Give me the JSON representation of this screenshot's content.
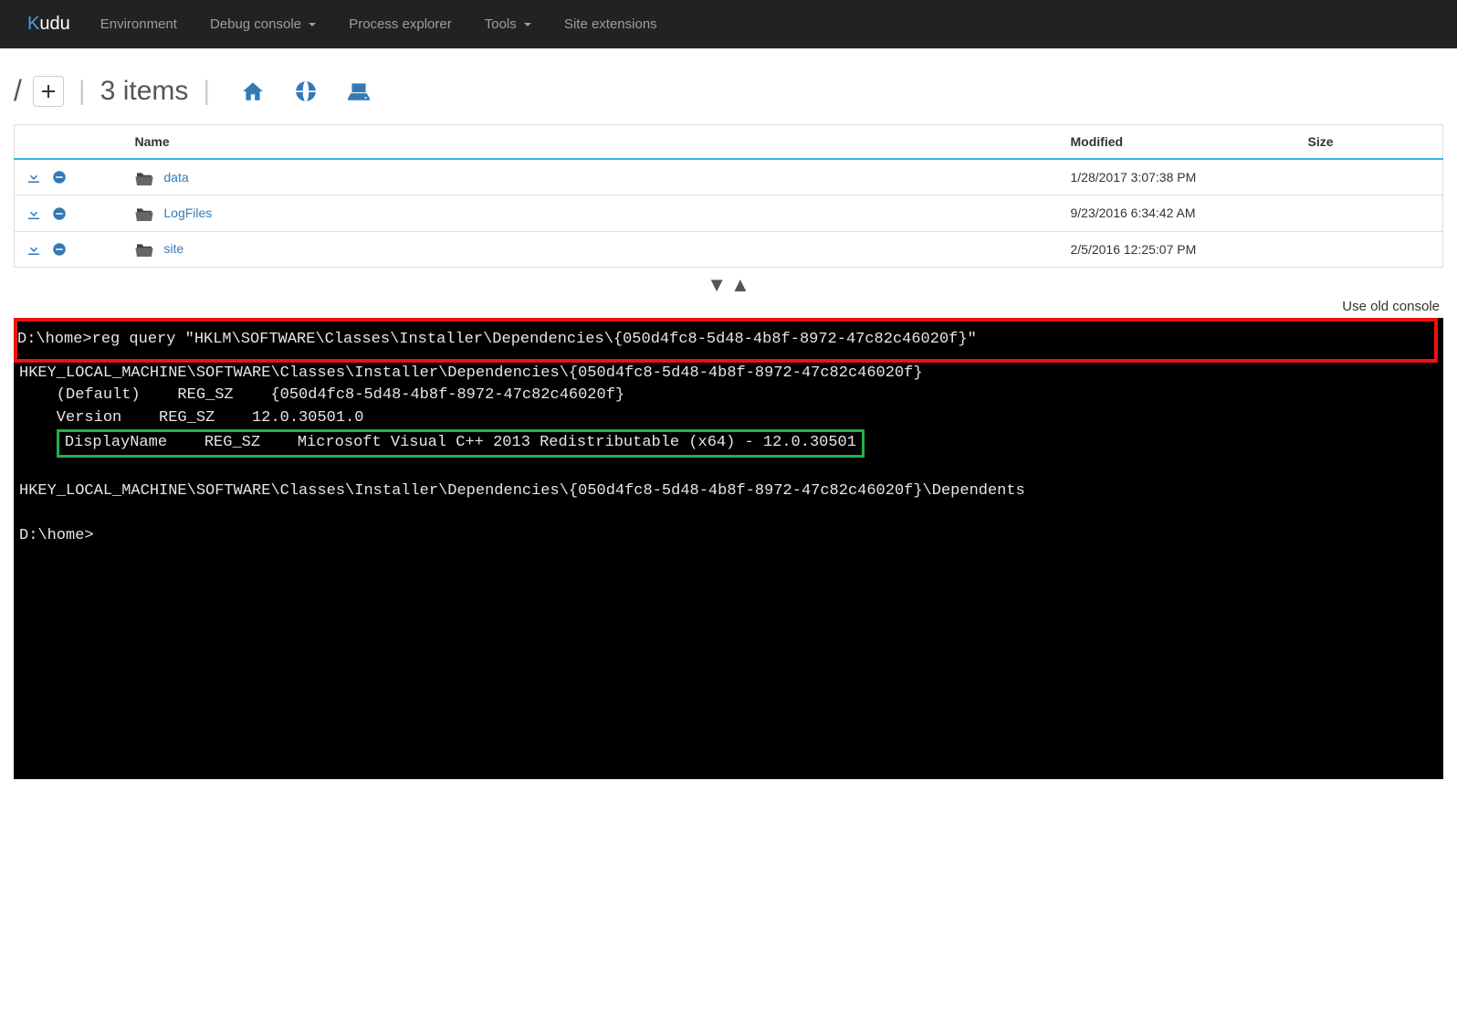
{
  "brand": "udu",
  "nav": {
    "environment": "Environment",
    "debug_console": "Debug console",
    "process_explorer": "Process explorer",
    "tools": "Tools",
    "site_extensions": "Site extensions"
  },
  "breadcrumb": {
    "slash": "/",
    "items_count": "3 items"
  },
  "table": {
    "headers": {
      "name": "Name",
      "modified": "Modified",
      "size": "Size"
    },
    "rows": [
      {
        "name": "data",
        "modified": "1/28/2017 3:07:38 PM",
        "size": ""
      },
      {
        "name": "LogFiles",
        "modified": "9/23/2016 6:34:42 AM",
        "size": ""
      },
      {
        "name": "site",
        "modified": "2/5/2016 12:25:07 PM",
        "size": ""
      }
    ]
  },
  "old_console_label": "Use old console",
  "console": {
    "cmd": "D:\\home>reg query \"HKLM\\SOFTWARE\\Classes\\Installer\\Dependencies\\{050d4fc8-5d48-4b8f-8972-47c82c46020f}\"",
    "out_key": "HKEY_LOCAL_MACHINE\\SOFTWARE\\Classes\\Installer\\Dependencies\\{050d4fc8-5d48-4b8f-8972-47c82c46020f}",
    "out_default": "    (Default)    REG_SZ    {050d4fc8-5d48-4b8f-8972-47c82c46020f}",
    "out_version": "    Version    REG_SZ    12.0.30501.0",
    "out_displayname": "DisplayName    REG_SZ    Microsoft Visual C++ 2013 Redistributable (x64) - 12.0.30501",
    "out_dependents": "HKEY_LOCAL_MACHINE\\SOFTWARE\\Classes\\Installer\\Dependencies\\{050d4fc8-5d48-4b8f-8972-47c82c46020f}\\Dependents",
    "prompt": "D:\\home>"
  }
}
